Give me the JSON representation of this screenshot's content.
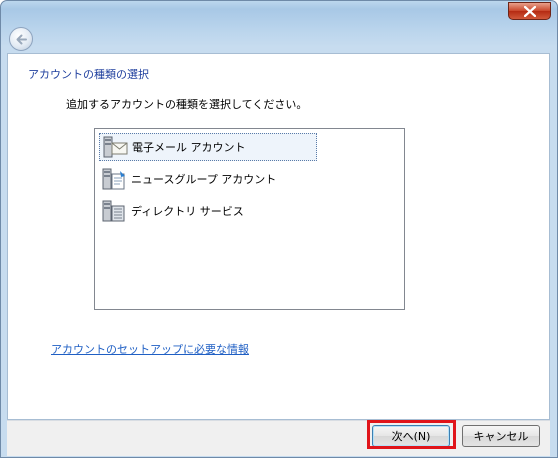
{
  "dialog": {
    "header_title": "アカウントの種類の選択",
    "instruction": "追加するアカウントの種類を選択してください。"
  },
  "account_types": [
    {
      "label": "電子メール アカウント",
      "icon": "email-account-icon",
      "selected": true
    },
    {
      "label": "ニュースグループ アカウント",
      "icon": "newsgroup-account-icon",
      "selected": false
    },
    {
      "label": "ディレクトリ サービス",
      "icon": "directory-service-icon",
      "selected": false
    }
  ],
  "help_link": "アカウントのセットアップに必要な情報",
  "buttons": {
    "next": "次へ(N)",
    "cancel": "キャンセル"
  },
  "colors": {
    "highlight": "#e0141a",
    "header": "#1f3f9e",
    "link": "#1f5fc4"
  }
}
